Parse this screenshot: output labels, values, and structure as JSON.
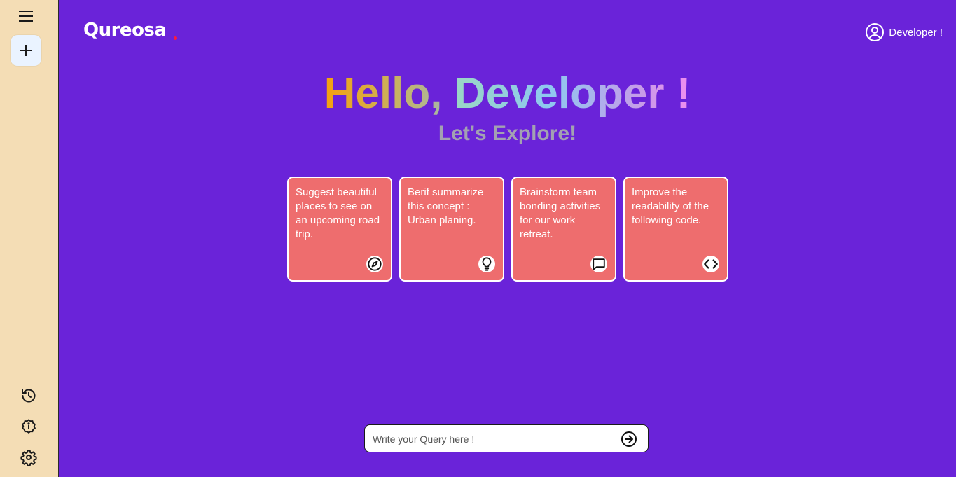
{
  "sidebar": {
    "menu_icon": "hamburger-menu-icon",
    "new_chat_icon": "plus-icon",
    "bottom_icons": [
      "history-icon",
      "info-icon",
      "settings-gear-icon"
    ]
  },
  "header": {
    "logo_text": "Qureosa",
    "logo_dot_color": "#ff1a3a",
    "user_icon": "user-circle-icon",
    "user_name": "Developer !"
  },
  "greeting": {
    "hello": "Hello,",
    "name": "Developer !",
    "subtitle": "Let's Explore!"
  },
  "cards": [
    {
      "text": "Suggest beautiful places to see on an upcoming road trip.",
      "icon": "compass-icon"
    },
    {
      "text": "Berif summarize this concept : Urban planing.",
      "icon": "lightbulb-icon"
    },
    {
      "text": "Brainstorm team bonding activities for our work retreat.",
      "icon": "message-icon"
    },
    {
      "text": "Improve the readability of the following code.",
      "icon": "code-icon"
    }
  ],
  "query": {
    "placeholder": "Write your Query here !",
    "send_icon": "arrow-circle-right-icon"
  },
  "colors": {
    "sidebar_bg": "#f4ddb5",
    "main_bg": "#6a23d9",
    "card_bg": "#ee6d6e",
    "subtitle": "#a3a1b2"
  }
}
